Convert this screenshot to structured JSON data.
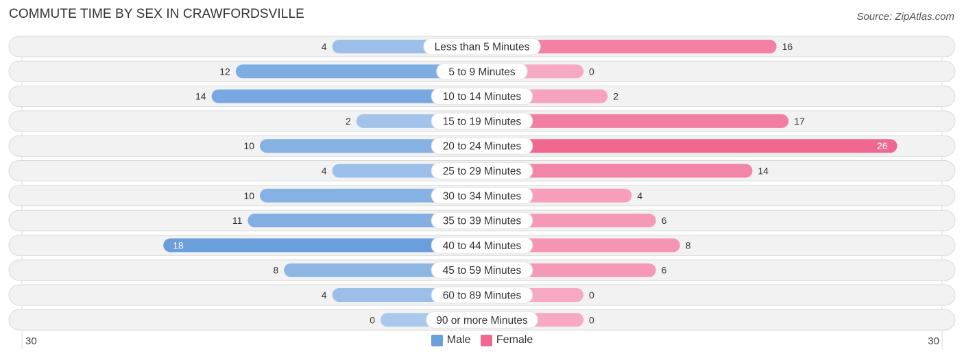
{
  "title": "COMMUTE TIME BY SEX IN CRAWFORDSVILLE",
  "source": "Source: ZipAtlas.com",
  "colors": {
    "male": "#6a9fdb",
    "male_light": "#a9c8ec",
    "female": "#f06890",
    "female_light": "#f7a8c2",
    "track": "#f2f2f2",
    "track_border": "#d9d9d9"
  },
  "chart_data": {
    "type": "bar",
    "orientation": "horizontal-diverging",
    "title": "COMMUTE TIME BY SEX IN CRAWFORDSVILLE",
    "categories": [
      "Less than 5 Minutes",
      "5 to 9 Minutes",
      "10 to 14 Minutes",
      "15 to 19 Minutes",
      "20 to 24 Minutes",
      "25 to 29 Minutes",
      "30 to 34 Minutes",
      "35 to 39 Minutes",
      "40 to 44 Minutes",
      "45 to 59 Minutes",
      "60 to 89 Minutes",
      "90 or more Minutes"
    ],
    "series": [
      {
        "name": "Male",
        "values": [
          4,
          12,
          14,
          2,
          10,
          4,
          10,
          11,
          18,
          8,
          4,
          0
        ]
      },
      {
        "name": "Female",
        "values": [
          16,
          0,
          2,
          17,
          26,
          14,
          4,
          6,
          8,
          6,
          0,
          0
        ]
      }
    ],
    "axis_min_label": "30",
    "axis_max_label": "30",
    "xlim": [
      -30,
      30
    ],
    "legend": [
      "Male",
      "Female"
    ],
    "legend_position": "bottom-center"
  }
}
